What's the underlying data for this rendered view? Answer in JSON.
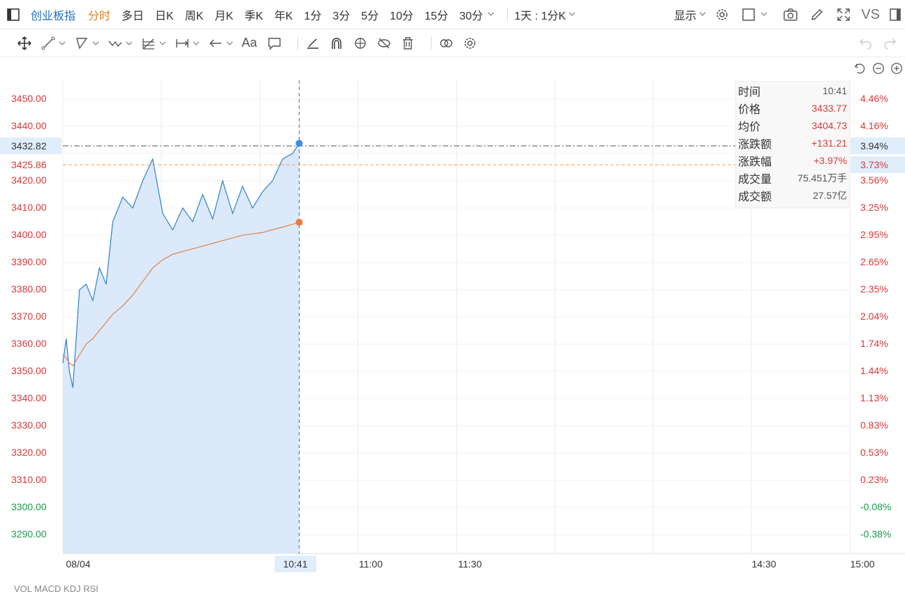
{
  "toolbar": {
    "title": "创业板指",
    "periods": [
      "分时",
      "多日",
      "日K",
      "周K",
      "月K",
      "季K",
      "年K",
      "1分",
      "3分",
      "5分",
      "10分",
      "15分",
      "30分"
    ],
    "active_period": "分时",
    "interval_label": "1天 : 1分K",
    "display_label": "显示",
    "vs_label": "VS"
  },
  "drawing_tools": [
    "move-icon",
    "line-icon",
    "rect-icon",
    "wave-icon",
    "fib-icon",
    "range-icon",
    "arrow-icon",
    "text-icon",
    "comment-icon",
    "ruler-icon",
    "magnet-icon",
    "lock-icon",
    "hide-icon",
    "trash-icon",
    "link-icon",
    "settings-icon"
  ],
  "text_tool_label": "Aa",
  "left_axis": {
    "ticks": [
      "3450.00",
      "3440.00",
      "3420.00",
      "3410.00",
      "3400.00",
      "3390.00",
      "3380.00",
      "3370.00",
      "3360.00",
      "3350.00",
      "3340.00",
      "3330.00",
      "3320.00",
      "3310.00",
      "3300.00",
      "3290.00"
    ],
    "highlight_price": "3432.82",
    "prev_close": "3425.86"
  },
  "right_axis": {
    "ticks": [
      "4.46%",
      "4.16%",
      "3.56%",
      "3.25%",
      "2.95%",
      "2.65%",
      "2.35%",
      "2.04%",
      "1.74%",
      "1.44%",
      "1.13%",
      "0.83%",
      "0.53%",
      "0.23%",
      "-0.08%",
      "-0.38%"
    ],
    "highlight_pct": "3.94%",
    "prev_close_pct": "3.73%"
  },
  "x_axis": {
    "labels": [
      "08/04",
      "11:00",
      "11:30",
      "14:30",
      "15:00"
    ],
    "cursor_label": "10:41"
  },
  "info": {
    "rows": [
      {
        "k": "时间",
        "v": "10:41"
      },
      {
        "k": "价格",
        "v": "3433.77"
      },
      {
        "k": "均价",
        "v": "3404.73"
      },
      {
        "k": "涨跌额",
        "v": "+131.21"
      },
      {
        "k": "涨跌幅",
        "v": "+3.97%"
      },
      {
        "k": "成交量",
        "v": "75.451万手"
      },
      {
        "k": "成交额",
        "v": "27.57亿"
      }
    ]
  },
  "bottom_tabs": "VOL    MACD    KDJ    RSI",
  "colors": {
    "price_line": "#2e7fd6",
    "avg_line": "#e07a37",
    "up": "#d9383a",
    "down": "#1a9a4a",
    "fill": "#d7e7fa"
  },
  "chart_data": {
    "type": "line",
    "x": [
      "09:30",
      "09:31",
      "09:32",
      "09:33",
      "09:35",
      "09:37",
      "09:39",
      "09:41",
      "09:43",
      "09:45",
      "09:48",
      "09:51",
      "09:54",
      "09:57",
      "10:00",
      "10:03",
      "10:06",
      "10:09",
      "10:12",
      "10:15",
      "10:18",
      "10:21",
      "10:24",
      "10:27",
      "10:30",
      "10:33",
      "10:36",
      "10:39",
      "10:41"
    ],
    "series": [
      {
        "values": [
          3353,
          3362,
          3350,
          3344,
          3380,
          3382,
          3376,
          3388,
          3382,
          3405,
          3414,
          3410,
          3420,
          3428,
          3408,
          3402,
          3410,
          3405,
          3415,
          3406,
          3420,
          3408,
          3418,
          3410,
          3416,
          3420,
          3428,
          3430,
          3433.77
        ]
      },
      {
        "values": [
          3356,
          3355,
          3353,
          3352,
          3356,
          3360,
          3362,
          3365,
          3368,
          3371,
          3374,
          3378,
          3383,
          3388,
          3391,
          3393,
          3394,
          3395,
          3396,
          3397,
          3398,
          3399,
          3400,
          3400.5,
          3401,
          3402,
          3403,
          3404,
          3404.73
        ]
      }
    ],
    "ylim": [
      3284,
      3459
    ],
    "x_range": [
      "09:30",
      "15:00"
    ]
  }
}
